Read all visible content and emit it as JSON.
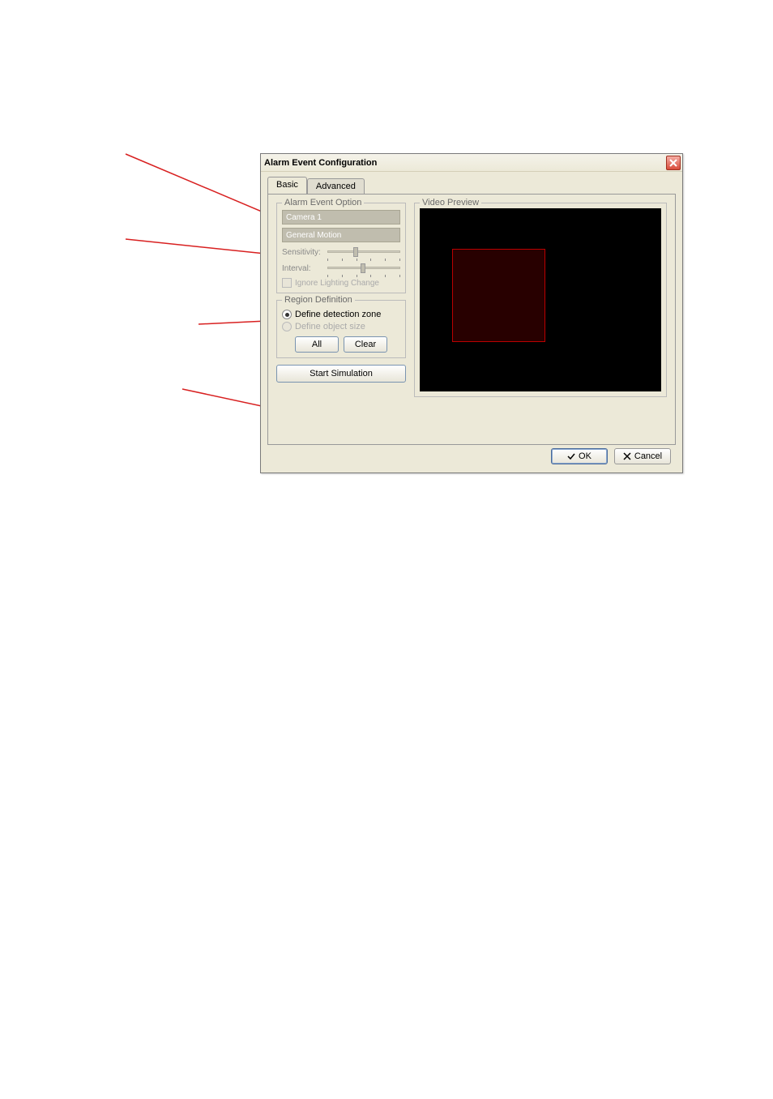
{
  "title": "Alarm Event Configuration",
  "tabs": {
    "basic": "Basic",
    "advanced": "Advanced",
    "active": "basic"
  },
  "alarm_event_option": {
    "legend": "Alarm Event Option",
    "camera": "Camera 1",
    "mode": "General Motion",
    "sensitivity_label": "Sensitivity:",
    "interval_label": "Interval:",
    "ignore_lighting": "Ignore Lighting Change"
  },
  "region_definition": {
    "legend": "Region Definition",
    "define_zone": "Define detection zone",
    "define_size": "Define object size",
    "all": "All",
    "clear": "Clear"
  },
  "start_simulation": "Start Simulation",
  "video_preview": "Video Preview",
  "footer": {
    "ok": "OK",
    "cancel": "Cancel"
  }
}
